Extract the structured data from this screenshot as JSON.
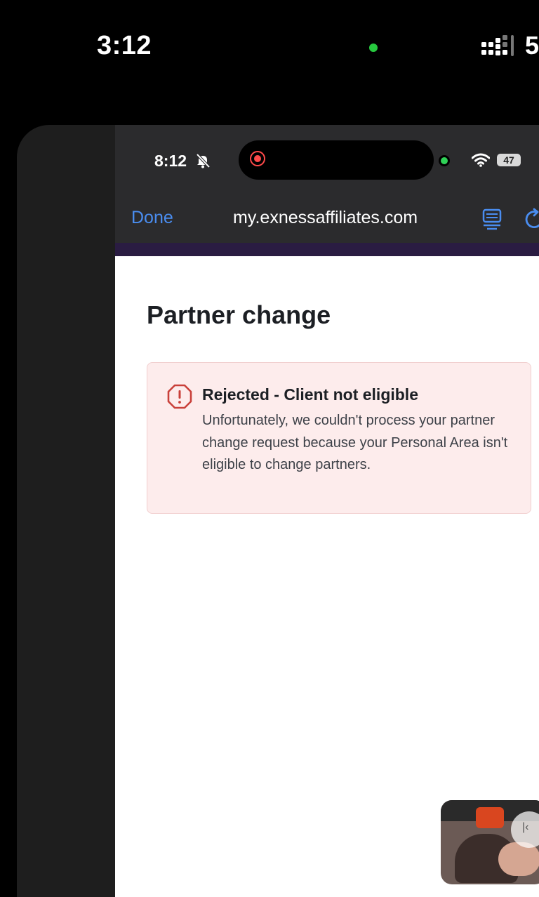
{
  "outer_status_bar": {
    "time": "3:12",
    "battery_partial": "5"
  },
  "inner_status_bar": {
    "time": "8:12",
    "battery": "47"
  },
  "browser": {
    "done_label": "Done",
    "url": "my.exnessaffiliates.com"
  },
  "page": {
    "title": "Partner change",
    "alert": {
      "title": "Rejected - Client not eligible",
      "message": "Unfortunately, we couldn't process your partner change request because your Personal Area isn't eligible to change partners."
    }
  },
  "icons": {
    "outer": [
      "signal-bars-icon",
      "green-privacy-dot"
    ],
    "inner": [
      "bell-slash-icon",
      "screen-record-icon",
      "wifi-icon",
      "battery-icon"
    ],
    "toolbar": [
      "reader-icon",
      "reload-icon"
    ],
    "alert": "warning-octagon-icon"
  },
  "colors": {
    "link_blue": "#4a8df0",
    "alert_bg": "#fdecec",
    "alert_icon": "#c9403a",
    "privacy_green": "#27c93f",
    "record_red": "#ff4a4a"
  }
}
